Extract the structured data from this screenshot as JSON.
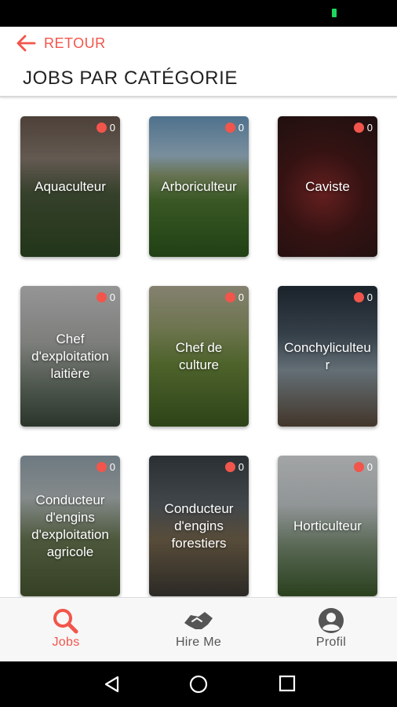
{
  "header": {
    "back_label": "RETOUR",
    "title": "JOBS PAR CATÉGORIE"
  },
  "categories": [
    {
      "title": "Aquaculteur",
      "count": "0"
    },
    {
      "title": "Arboriculteur",
      "count": "0"
    },
    {
      "title": "Caviste",
      "count": "0"
    },
    {
      "title": "Chef d'exploitation laitière",
      "count": "0"
    },
    {
      "title": "Chef de culture",
      "count": "0"
    },
    {
      "title": "Conchyliculteur",
      "count": "0"
    },
    {
      "title": "Conducteur d'engins d'exploitation agricole",
      "count": "0"
    },
    {
      "title": "Conducteur d'engins forestiers",
      "count": "0"
    },
    {
      "title": "Horticulteur",
      "count": "0"
    }
  ],
  "bottom_nav": {
    "items": [
      {
        "label": "Jobs",
        "icon": "search-icon",
        "active": true
      },
      {
        "label": "Hire Me",
        "icon": "handshake-icon",
        "active": false
      },
      {
        "label": "Profil",
        "icon": "account-icon",
        "active": false
      }
    ]
  },
  "colors": {
    "accent": "#f2554b",
    "inactive": "#555555",
    "badge": "#f2554b"
  }
}
